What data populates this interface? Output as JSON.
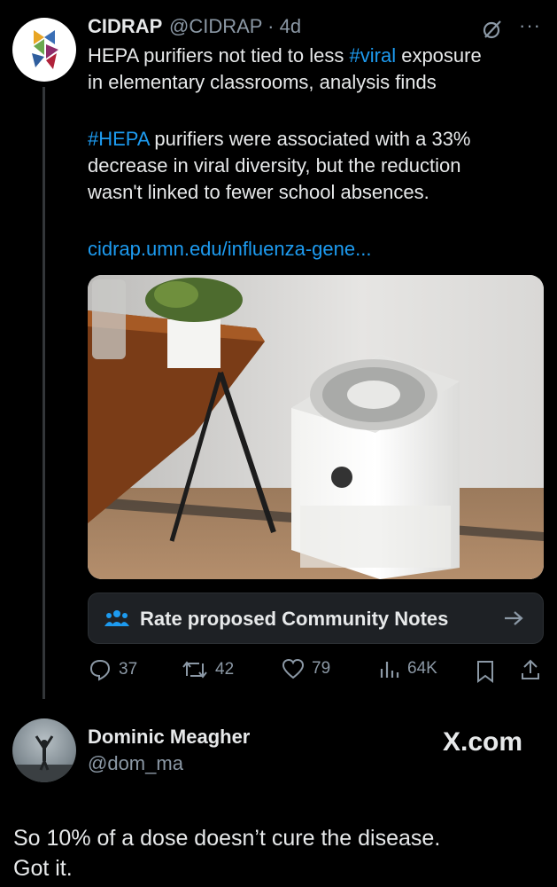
{
  "tweet": {
    "author_name": "CIDRAP",
    "handle": "@CIDRAP",
    "time": "4d",
    "line1_pre": "HEPA purifiers not tied to less ",
    "line1_tag": "#viral",
    "line1_post": " exposure",
    "line2": "in elementary classrooms, analysis finds",
    "para2_tag": "#HEPA",
    "para2_line1": " purifiers were associated with a 33%",
    "para2_line2": "decrease in viral diversity, but the reduction",
    "para2_line3": "wasn't linked to fewer school absences.",
    "link": "cidrap.umn.edu/influenza-gene...",
    "community_notes": "Rate proposed Community Notes",
    "replies": "37",
    "retweets": "42",
    "likes": "79",
    "views": "64K"
  },
  "reply_card": {
    "name": "Dominic Meagher",
    "handle": "@dom_ma",
    "brand": "X.com",
    "text_line1": "So 10% of a dose doesn’t cure the disease.",
    "text_line2": "Got it."
  },
  "colors": {
    "background": "#000000",
    "text": "#e7e9ea",
    "muted": "#8b98a5",
    "accent": "#1d9bf0"
  }
}
